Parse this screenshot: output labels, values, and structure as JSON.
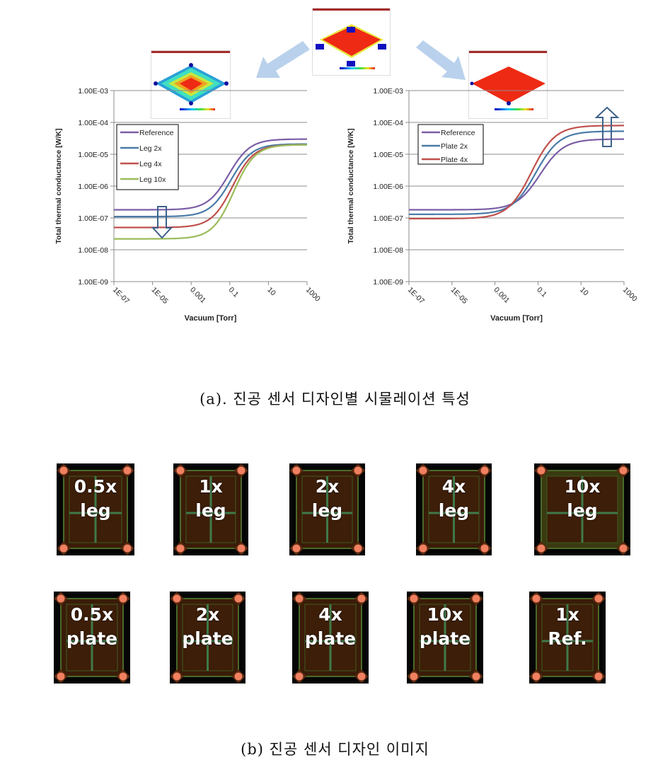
{
  "captions": {
    "a": "(a). 진공 센서 디자인별 시물레이션 특성",
    "b": "(b) 진공 센서 디자인 이미지"
  },
  "colors": {
    "reference": "#7b5ea7",
    "series2": "#4a7ba7",
    "series3": "#c0504d",
    "series4": "#9bbb59",
    "arrow_light": "#b9d1ec",
    "arrow_outline": "#3e6289"
  },
  "thumbnails": [
    {
      "name": "center-simulation",
      "description": "reference thermal map"
    },
    {
      "name": "left-simulation",
      "description": "leg variation thermal map"
    },
    {
      "name": "right-simulation",
      "description": "plate variation thermal map"
    }
  ],
  "chart_data": [
    {
      "type": "line",
      "title": "",
      "xlabel": "Vacuum [Torr]",
      "ylabel": "Total thermal conductance [W/K]",
      "xscale": "log",
      "yscale": "log",
      "xlim": [
        1e-07,
        1000
      ],
      "ylim": [
        1e-09,
        0.001
      ],
      "xticks": [
        "1E-07",
        "1E-05",
        "0.001",
        "0.1",
        "10",
        "1000"
      ],
      "yticks": [
        "1.00E-03",
        "1.00E-04",
        "1.00E-05",
        "1.00E-06",
        "1.00E-07",
        "1.00E-08",
        "1.00E-09"
      ],
      "grid": true,
      "legend": "upper-left",
      "annotation": "down arrow near 1E-05 indicating decreasing low-pressure conductance",
      "series": [
        {
          "name": "Reference",
          "color_key": "reference",
          "low": 1.8e-07,
          "high": 3e-05,
          "mid_log_p": -1.05,
          "width": 0.55
        },
        {
          "name": "Leg 2x",
          "color_key": "series2",
          "low": 1.1e-07,
          "high": 2.1e-05,
          "mid_log_p": -0.95,
          "width": 0.55
        },
        {
          "name": "Leg 4x",
          "color_key": "series3",
          "low": 5e-08,
          "high": 2e-05,
          "mid_log_p": -0.85,
          "width": 0.55
        },
        {
          "name": "Leg 10x",
          "color_key": "series4",
          "low": 2.2e-08,
          "high": 2e-05,
          "mid_log_p": -0.8,
          "width": 0.55
        }
      ]
    },
    {
      "type": "line",
      "title": "",
      "xlabel": "Vacuum [Torr]",
      "ylabel": "Total thermal conductance [W/K]",
      "xscale": "log",
      "yscale": "log",
      "xlim": [
        1e-07,
        1000
      ],
      "ylim": [
        1e-09,
        0.001
      ],
      "xticks": [
        "1E-07",
        "1E-05",
        "0.001",
        "0.1",
        "10",
        "1000"
      ],
      "yticks": [
        "1.00E-03",
        "1.00E-04",
        "1.00E-05",
        "1.00E-06",
        "1.00E-07",
        "1.00E-08",
        "1.00E-09"
      ],
      "grid": true,
      "legend": "upper-left",
      "annotation": "up arrow near 100 indicating increasing high-pressure conductance",
      "series": [
        {
          "name": "Reference",
          "color_key": "reference",
          "low": 1.8e-07,
          "high": 3e-05,
          "mid_log_p": -0.9,
          "width": 0.55
        },
        {
          "name": "Plate 2x",
          "color_key": "series2",
          "low": 1.3e-07,
          "high": 5.3e-05,
          "mid_log_p": -1.1,
          "width": 0.55
        },
        {
          "name": "Plate 4x",
          "color_key": "series3",
          "low": 9.5e-08,
          "high": 8e-05,
          "mid_log_p": -1.3,
          "width": 0.55
        }
      ]
    }
  ],
  "design_images": {
    "row1": [
      {
        "line1": "0.5x",
        "line2": "leg"
      },
      {
        "line1": "1x",
        "line2": "leg"
      },
      {
        "line1": "2x",
        "line2": "leg"
      },
      {
        "line1": "4x",
        "line2": "leg"
      },
      {
        "line1": "10x",
        "line2": "leg"
      }
    ],
    "row2": [
      {
        "line1": "0.5x",
        "line2": "plate"
      },
      {
        "line1": "2x",
        "line2": "plate"
      },
      {
        "line1": "4x",
        "line2": "plate"
      },
      {
        "line1": "10x",
        "line2": "plate"
      },
      {
        "line1": "1x",
        "line2": "Ref."
      }
    ]
  }
}
